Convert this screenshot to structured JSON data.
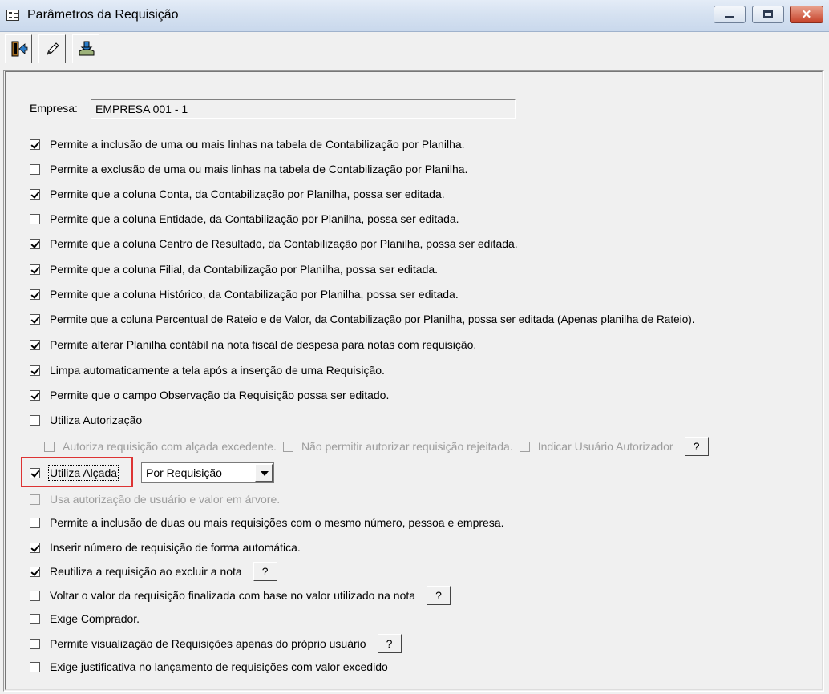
{
  "window": {
    "title": "Parâmetros da Requisição"
  },
  "toolbar": {
    "buttons": [
      {
        "name": "exit",
        "icon": "exit-door-icon"
      },
      {
        "name": "edit",
        "icon": "pencil-icon"
      },
      {
        "name": "save",
        "icon": "save-tray-icon"
      }
    ]
  },
  "empresa": {
    "label": "Empresa:",
    "value": "EMPRESA 001 - 1"
  },
  "options": [
    {
      "label": "Permite a inclusão de uma ou mais linhas na tabela de Contabilização por Planilha.",
      "checked": true
    },
    {
      "label": "Permite a exclusão de uma ou mais linhas na tabela de Contabilização por Planilha.",
      "checked": false
    },
    {
      "label": "Permite que a coluna Conta, da Contabilização por Planilha, possa ser editada.",
      "checked": true
    },
    {
      "label": "Permite que a coluna Entidade, da Contabilização por Planilha, possa ser editada.",
      "checked": false
    },
    {
      "label": "Permite que a coluna Centro de Resultado, da Contabilização por Planilha, possa ser editada.",
      "checked": true
    },
    {
      "label": "Permite que a coluna Filial, da Contabilização por Planilha, possa ser editada.",
      "checked": true
    },
    {
      "label": "Permite que a coluna Histórico, da Contabilização por Planilha, possa ser editada.",
      "checked": true
    },
    {
      "label": "Permite que a coluna Percentual de Rateio e de Valor, da Contabilização por Planilha, possa ser editada (Apenas planilha de Rateio).",
      "checked": true
    },
    {
      "label": "Permite alterar Planilha contábil na nota fiscal de despesa para notas com requisição.",
      "checked": true
    },
    {
      "label": "Limpa automaticamente a tela após a inserção de uma Requisição.",
      "checked": true
    },
    {
      "label": "Permite que o campo Observação da Requisição possa ser editado.",
      "checked": true
    },
    {
      "label": "Utiliza Autorização",
      "checked": false
    }
  ],
  "autorizacao_sub": {
    "items": [
      {
        "label": "Autoriza requisição com alçada excedente.",
        "checked": false
      },
      {
        "label": "Não permitir autorizar requisição rejeitada.",
        "checked": false
      },
      {
        "label": "Indicar Usuário Autorizador",
        "checked": false
      }
    ],
    "help_label": "?"
  },
  "alcada": {
    "label": "Utiliza Alçada",
    "checked": true,
    "select_value": "Por Requisição"
  },
  "arvore": {
    "label": "Usa autorização de usuário e valor em árvore.",
    "checked": false
  },
  "options2": [
    {
      "label": "Permite a inclusão de duas ou mais requisições com o mesmo número, pessoa e empresa.",
      "checked": false
    },
    {
      "label": "Inserir número de requisição de forma automática.",
      "checked": true
    },
    {
      "label": "Reutiliza a requisição ao excluir a nota",
      "checked": true,
      "help": "?"
    },
    {
      "label": "Voltar o valor da requisição finalizada com base no valor utilizado na nota",
      "checked": false,
      "help": "?"
    },
    {
      "label": "Exige Comprador.",
      "checked": false
    },
    {
      "label": "Permite visualização de Requisições apenas do próprio usuário",
      "checked": false,
      "help": "?"
    },
    {
      "label": "Exige justificativa no lançamento de requisições com valor excedido",
      "checked": false
    }
  ]
}
